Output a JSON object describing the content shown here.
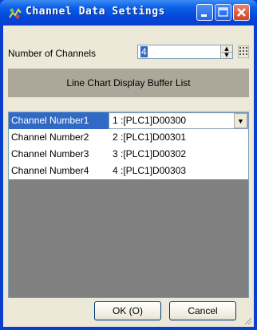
{
  "window": {
    "title": "Channel Data Settings",
    "title_color": "#ffffff",
    "accent": "#0a3fce"
  },
  "controls": {
    "num_channels_label": "Number of Channels",
    "num_channels_value": "4",
    "buffer_header": "Line Chart Display Buffer List"
  },
  "channels": [
    {
      "name": "Channel Number1",
      "value": "1 :[PLC1]D00300"
    },
    {
      "name": "Channel Number2",
      "value": "2 :[PLC1]D00301"
    },
    {
      "name": "Channel Number3",
      "value": "3 :[PLC1]D00302"
    },
    {
      "name": "Channel Number4",
      "value": "4 :[PLC1]D00303"
    }
  ],
  "buttons": {
    "ok": "OK (O)",
    "cancel": "Cancel"
  },
  "icons": {
    "app": "app-icon",
    "minimize": "minimize-icon",
    "maximize": "maximize-icon",
    "close": "close-icon",
    "spin": "spin-icon",
    "keypad": "keypad-icon",
    "dropdown": "chevron-down-icon"
  }
}
